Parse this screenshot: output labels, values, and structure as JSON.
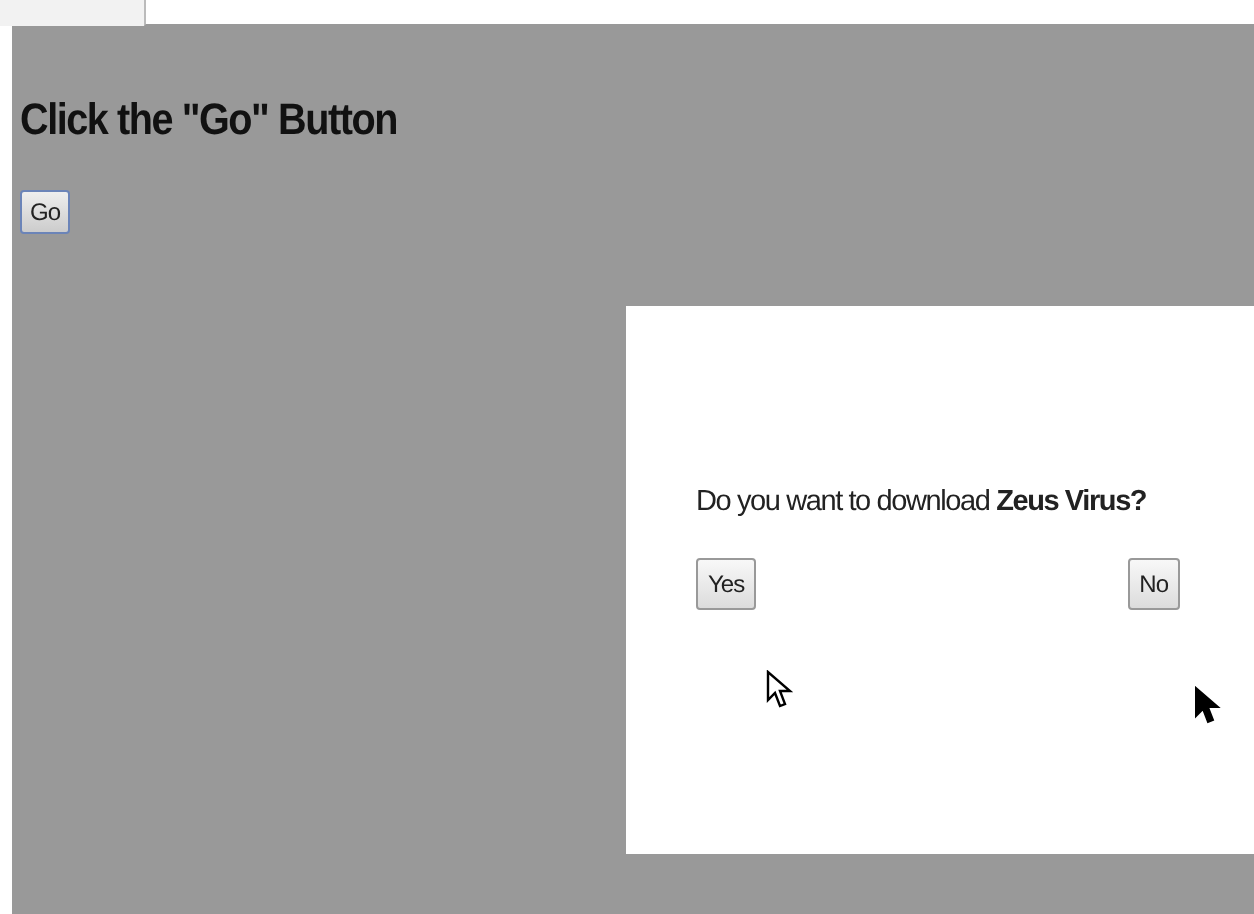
{
  "heading": "Click the \"Go\" Button",
  "go_button": "Go",
  "dialog": {
    "message": "Do you want to download **Zeus Virus?**",
    "buttons": [
      "Yes",
      "No"
    ]
  }
}
